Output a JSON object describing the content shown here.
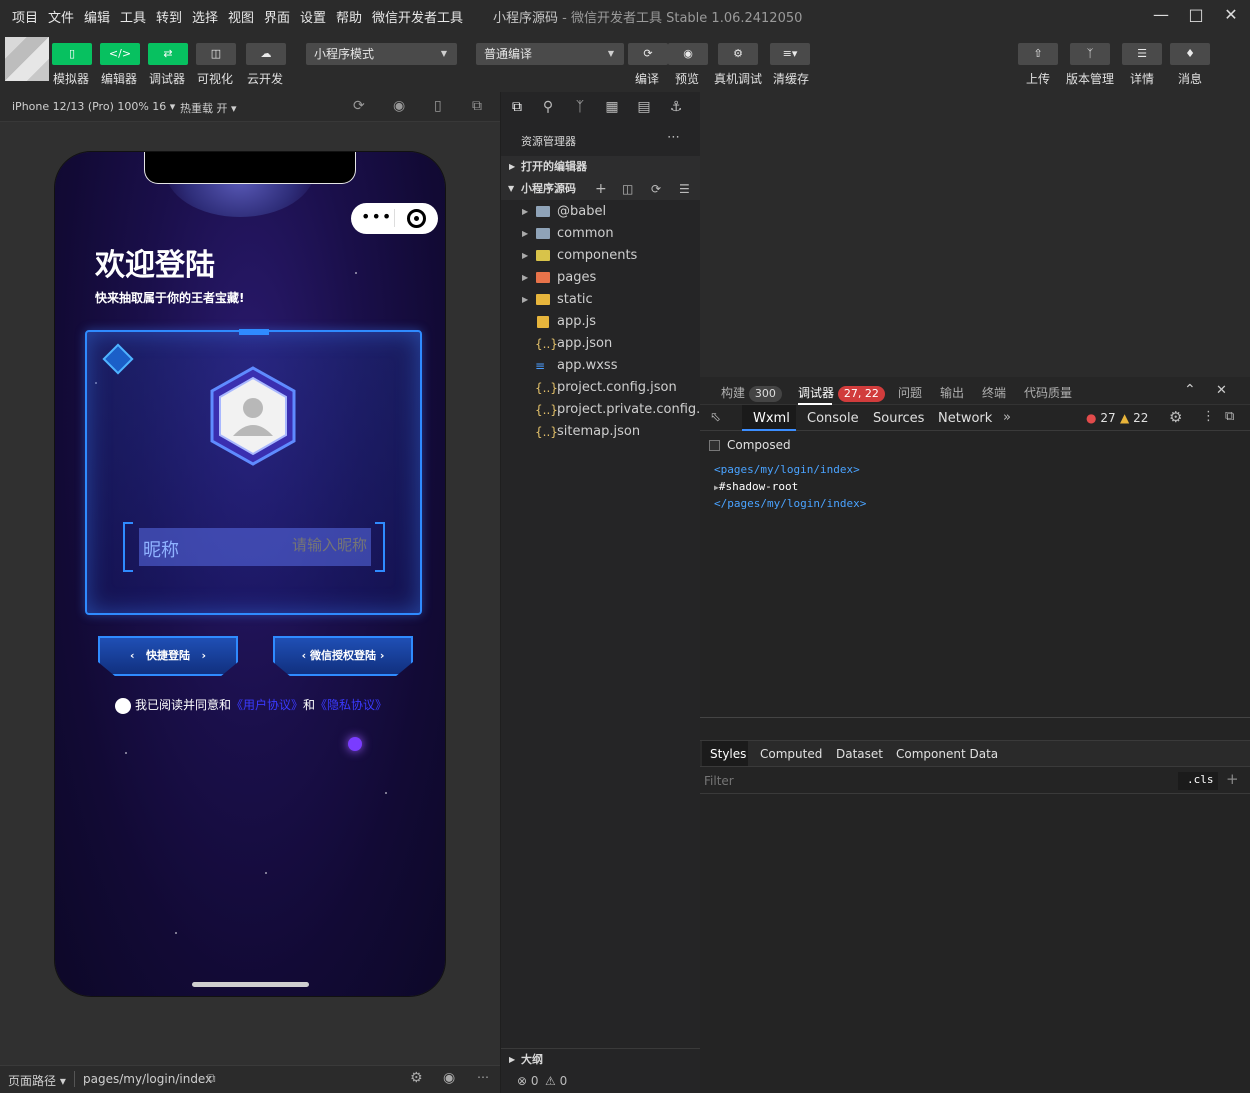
{
  "titlebar": {
    "menus": [
      "项目",
      "文件",
      "编辑",
      "工具",
      "转到",
      "选择",
      "视图",
      "界面",
      "设置",
      "帮助",
      "微信开发者工具"
    ],
    "title": "小程序源码",
    "subtitle": "- 微信开发者工具 Stable 1.06.2412050"
  },
  "toolbar": {
    "simulator": "模拟器",
    "editor": "编辑器",
    "debugger": "调试器",
    "visual": "可视化",
    "cloud": "云开发",
    "mode": "小程序模式",
    "compile_mode": "普通编译",
    "compile": "编译",
    "preview": "预览",
    "real_debug": "真机调试",
    "clear_cache": "清缓存",
    "upload": "上传",
    "version": "版本管理",
    "detail": "详情",
    "message": "消息"
  },
  "sim_bar": {
    "device": "iPhone 12/13 (Pro) 100% 16",
    "hot_reload": "热重载 开"
  },
  "phone": {
    "welcome": "欢迎登陆",
    "subtitle": "快来抽取属于你的王者宝藏!",
    "nick_label": "昵称",
    "nick_placeholder": "请输入昵称",
    "quick_login": "快捷登陆",
    "wechat_login": "微信授权登陆",
    "agree_prefix": "我已阅读并同意和",
    "user_agreement": "《用户协议》",
    "and": "和",
    "privacy": "《隐私协议》"
  },
  "left_status": {
    "path_label": "页面路径",
    "path": "pages/my/login/index"
  },
  "explorer": {
    "title": "资源管理器",
    "open_editors": "打开的编辑器",
    "project": "小程序源码",
    "items": [
      {
        "name": "@babel",
        "type": "folder",
        "color": "#8fa3b8"
      },
      {
        "name": "common",
        "type": "folder",
        "color": "#8fa3b8"
      },
      {
        "name": "components",
        "type": "folder",
        "color": "#d8c34a"
      },
      {
        "name": "pages",
        "type": "folder",
        "color": "#e8734a"
      },
      {
        "name": "static",
        "type": "folder",
        "color": "#e7b53c"
      },
      {
        "name": "app.js",
        "type": "js"
      },
      {
        "name": "app.json",
        "type": "json"
      },
      {
        "name": "app.wxss",
        "type": "wxss"
      },
      {
        "name": "project.config.json",
        "type": "json"
      },
      {
        "name": "project.private.config.js...",
        "type": "json"
      },
      {
        "name": "sitemap.json",
        "type": "json"
      }
    ],
    "outline": "大纲",
    "errors": "0",
    "warnings": "0"
  },
  "devtools": {
    "tabs": {
      "build": "构建",
      "build_count": "300",
      "debugger": "调试器",
      "debugger_count": "27, 22",
      "issues": "问题",
      "output": "输出",
      "terminal": "终端",
      "quality": "代码质量"
    },
    "console_tabs": [
      "Wxml",
      "Console",
      "Sources",
      "Network"
    ],
    "error_count": "27",
    "warning_count": "22",
    "composed": "Composed",
    "code": {
      "open_tag": "<pages/my/login/index>",
      "shadow": "#shadow-root",
      "close_tag": "</pages/my/login/index>"
    },
    "styles_tabs": [
      "Styles",
      "Computed",
      "Dataset",
      "Component Data"
    ],
    "filter_placeholder": "Filter",
    "cls": ".cls"
  }
}
